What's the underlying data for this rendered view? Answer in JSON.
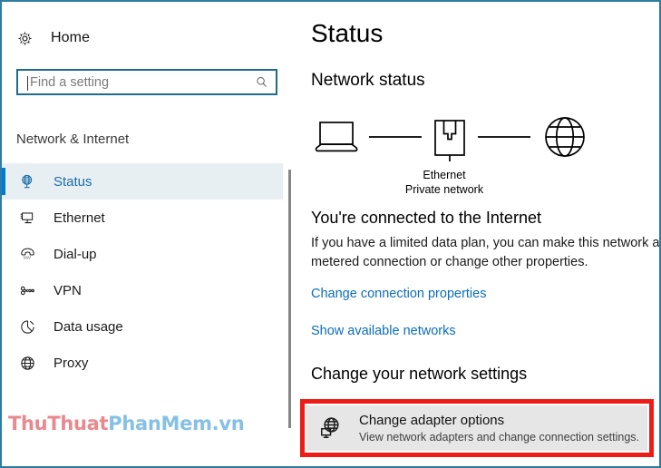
{
  "window": {
    "border_color": "#2f7ca3"
  },
  "sidebar": {
    "home_label": "Home",
    "home_icon": "gear-icon",
    "search": {
      "placeholder": "Find a setting",
      "value": "",
      "icon": "search-icon"
    },
    "section_title": "Network & Internet",
    "items": [
      {
        "label": "Status",
        "icon": "globe-monitor-icon",
        "selected": true
      },
      {
        "label": "Ethernet",
        "icon": "ethernet-icon",
        "selected": false
      },
      {
        "label": "Dial-up",
        "icon": "telephone-icon",
        "selected": false
      },
      {
        "label": "VPN",
        "icon": "vpn-link-icon",
        "selected": false
      },
      {
        "label": "Data usage",
        "icon": "pie-chart-icon",
        "selected": false
      },
      {
        "label": "Proxy",
        "icon": "globe-icon",
        "selected": false
      }
    ],
    "accent_color": "#0078d7",
    "selected_bg": "#e8eff3"
  },
  "watermark": {
    "part1": "ThuThuat",
    "part2": "PhanMem.vn",
    "color1": "#e8888f",
    "color2": "#86c0e4"
  },
  "main": {
    "page_title": "Status",
    "status_heading": "Network status",
    "diagram": {
      "device_icon": "laptop-icon",
      "adapter_icon": "ethernet-port-icon",
      "internet_icon": "globe-icon",
      "adapter_label": "Ethernet",
      "network_type_label": "Private network"
    },
    "connected_title": "You're connected to the Internet",
    "connected_desc": "If you have a limited data plan, you can make this network a metered connection or change other properties.",
    "links": [
      {
        "label": "Change connection properties"
      },
      {
        "label": "Show available networks"
      }
    ],
    "change_heading": "Change your network settings",
    "adapter_tile": {
      "icon": "globe-monitor-icon",
      "title": "Change adapter options",
      "subtitle": "View network adapters and change connection settings.",
      "highlight_color": "#ed1c16",
      "background": "#e6e6e6"
    },
    "annotation": {
      "arrow_icon": "red-arrow-icon",
      "arrow_color": "#d81f10"
    }
  }
}
